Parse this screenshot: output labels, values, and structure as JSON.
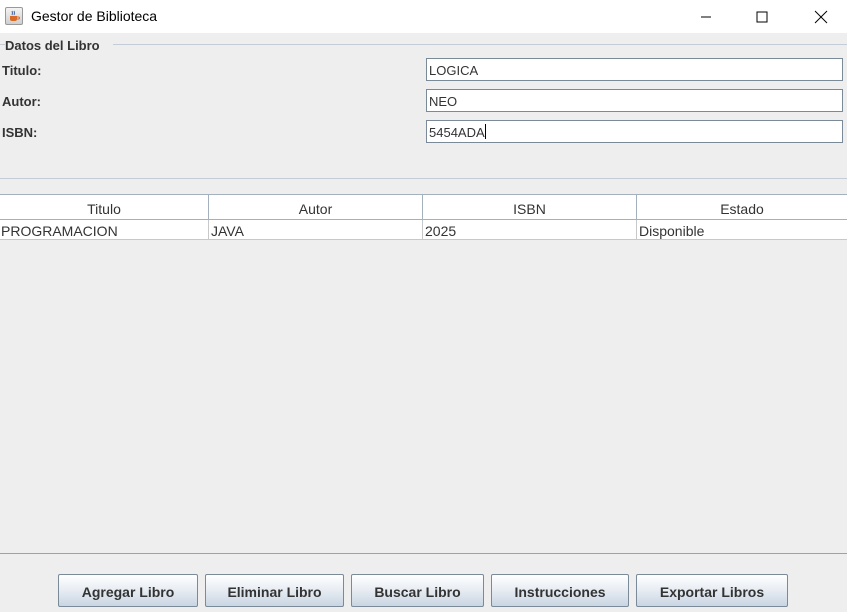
{
  "window": {
    "title": "Gestor de Biblioteca",
    "icon": "java-cup-icon",
    "controls": [
      "minimize-icon",
      "maximize-icon",
      "close-icon"
    ]
  },
  "form": {
    "legend": "Datos del Libro",
    "fields": [
      {
        "label": "Titulo:",
        "value": "LOGICA"
      },
      {
        "label": "Autor:",
        "value": "NEO"
      },
      {
        "label": "ISBN:",
        "value": "5454ADA"
      }
    ]
  },
  "table": {
    "columns": [
      "Titulo",
      "Autor",
      "ISBN",
      "Estado"
    ],
    "rows": [
      [
        "PROGRAMACION",
        "JAVA",
        "2025",
        "Disponible"
      ]
    ]
  },
  "buttons": {
    "add": "Agregar Libro",
    "delete": "Eliminar Libro",
    "search": "Buscar Libro",
    "instructions": "Instrucciones",
    "export": "Exportar Libros"
  }
}
